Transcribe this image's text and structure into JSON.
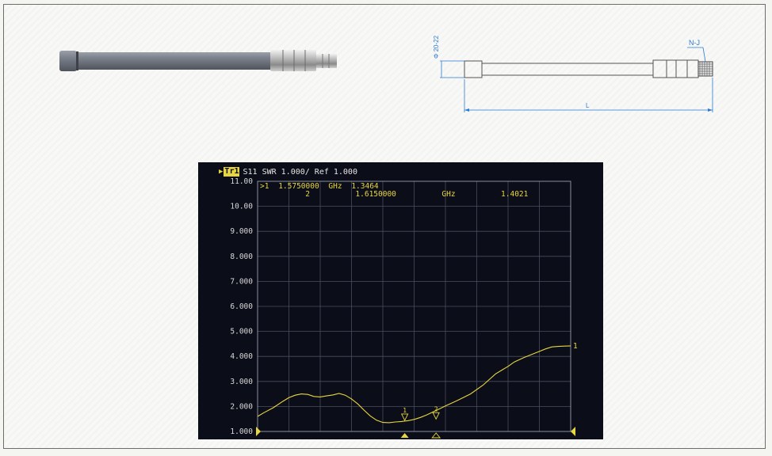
{
  "drawing": {
    "connector_label": "N-J",
    "diameter_label": "Φ 20-22",
    "length_label": "L"
  },
  "analyzer": {
    "trace_tag": "Tr1",
    "header_text": "S11  SWR 1.000/ Ref 1.000",
    "y_ticks": [
      "11.00",
      "10.00",
      "9.000",
      "8.000",
      "7.000",
      "6.000",
      "5.000",
      "4.000",
      "3.000",
      "2.000",
      "1.000"
    ],
    "markers": [
      {
        "prefix": ">1",
        "freq": "1.5750000",
        "unit": "GHz",
        "value": "1.3464"
      },
      {
        "prefix": " 2",
        "freq": "1.6150000",
        "unit": "GHz",
        "value": "1.4021"
      }
    ],
    "trace_end_label": "1",
    "marker_symbol_1": "1",
    "marker_symbol_2": "2"
  },
  "chart_data": {
    "type": "line",
    "title": "",
    "xlabel": "",
    "ylabel": "",
    "ylim": [
      1,
      11
    ],
    "xlim": [
      0,
      10
    ],
    "grid": true,
    "colors": {
      "trace": "#e8d640",
      "grid": "#4a4e5e",
      "background": "#0b0d18"
    },
    "series": [
      {
        "x": [
          0,
          0.2,
          0.5,
          0.8,
          1.0,
          1.2,
          1.4,
          1.6,
          1.8,
          2.0,
          2.2,
          2.4,
          2.6,
          2.8,
          3.0,
          3.2,
          3.4,
          3.6,
          3.8,
          4.0,
          4.2,
          4.4,
          4.6,
          4.8,
          5.0,
          5.2,
          5.4,
          5.6,
          5.8,
          6.0,
          6.4,
          6.8,
          7.2,
          7.6,
          8.0,
          8.2,
          8.5,
          8.8,
          9.0,
          9.2,
          9.4,
          9.6,
          9.8,
          10
        ],
        "y": [
          1.6,
          1.75,
          1.95,
          2.2,
          2.35,
          2.45,
          2.5,
          2.48,
          2.4,
          2.38,
          2.42,
          2.46,
          2.52,
          2.45,
          2.3,
          2.1,
          1.85,
          1.62,
          1.45,
          1.36,
          1.35,
          1.38,
          1.4,
          1.43,
          1.48,
          1.56,
          1.66,
          1.78,
          1.9,
          2.02,
          2.25,
          2.5,
          2.85,
          3.3,
          3.6,
          3.78,
          3.95,
          4.1,
          4.2,
          4.3,
          4.38,
          4.4,
          4.41,
          4.42
        ]
      }
    ],
    "markers": [
      {
        "x": 4.7,
        "y": 1.35
      },
      {
        "x": 5.7,
        "y": 1.4
      }
    ]
  }
}
